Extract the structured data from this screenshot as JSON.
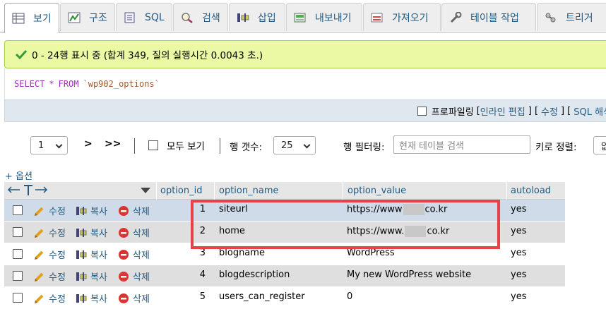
{
  "tabs": [
    {
      "label": "보기",
      "icon": "browse-icon",
      "active": true
    },
    {
      "label": "구조",
      "icon": "structure-icon",
      "active": false
    },
    {
      "label": "SQL",
      "icon": "sql-icon",
      "active": false
    },
    {
      "label": "검색",
      "icon": "search-icon",
      "active": false
    },
    {
      "label": "삽입",
      "icon": "insert-icon",
      "active": false
    },
    {
      "label": "내보내기",
      "icon": "export-icon",
      "active": false
    },
    {
      "label": "가져오기",
      "icon": "import-icon",
      "active": false
    },
    {
      "label": "테이블 작업",
      "icon": "wrench-icon",
      "active": false
    },
    {
      "label": "트리거",
      "icon": "triggers-icon",
      "active": false
    }
  ],
  "message": {
    "text": "0 - 24행 표시 중 (합계 349, 질의 실행시간 0.0043 초.)"
  },
  "query": {
    "select": "SELECT",
    "star": "*",
    "from": "FROM",
    "table": "`wp902_options`"
  },
  "profiling": {
    "label": "프로파일링",
    "open_bracket": "[",
    "inline_edit": "인라인 편집",
    "sep1": "] [",
    "edit": "수정",
    "sep2": "] [",
    "explain": "SQL 해석"
  },
  "nav": {
    "page_value": "1",
    "next": ">",
    "last": ">>",
    "show_all": "모두 보기",
    "rows_label": "행 갯수:",
    "rows_value": "25",
    "filter_label": "행 필터링:",
    "filter_placeholder": "현재 테이블 검색",
    "sort_label": "키로 정렬:",
    "sort_value": "없"
  },
  "options_label": "+ 옵션",
  "columns": [
    "option_id",
    "option_name",
    "option_value",
    "autoload"
  ],
  "actions": {
    "edit": "수정",
    "copy": "복사",
    "delete": "삭제"
  },
  "rows": [
    {
      "id": "1",
      "name": "siteurl",
      "value_prefix": "https://www",
      "value_suffix": "co.kr",
      "blurred": true,
      "autoload": "yes"
    },
    {
      "id": "2",
      "name": "home",
      "value_prefix": "https://www.",
      "value_suffix": "co.kr",
      "blurred": true,
      "autoload": "yes"
    },
    {
      "id": "3",
      "name": "blogname",
      "value_prefix": "WordPress",
      "value_suffix": "",
      "blurred": false,
      "autoload": "yes"
    },
    {
      "id": "4",
      "name": "blogdescription",
      "value_prefix": "My new WordPress website",
      "value_suffix": "",
      "blurred": false,
      "autoload": "yes"
    },
    {
      "id": "5",
      "name": "users_can_register",
      "value_prefix": "0",
      "value_suffix": "",
      "blurred": false,
      "autoload": "yes"
    }
  ],
  "colors": {
    "link": "#235a81",
    "success_bg": "#ebf8a4",
    "highlight": "#e8414b",
    "row_hover": "#cfdbe9"
  }
}
